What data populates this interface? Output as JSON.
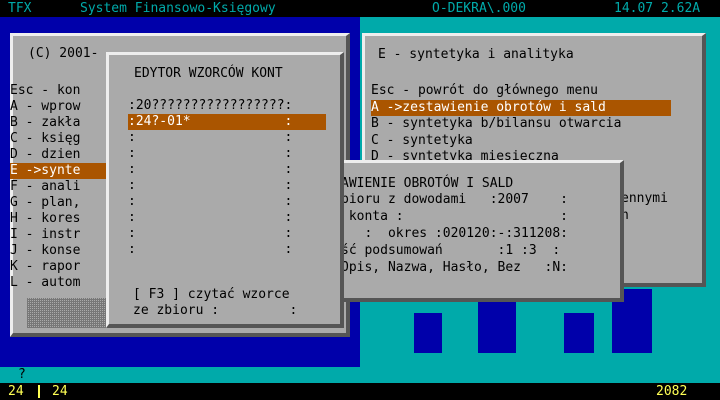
{
  "topbar": {
    "app": "TFX",
    "title": "System Finansowo-Księgowy",
    "path": "O-DEKRA\\.000",
    "time_version": "14.07 2.62A"
  },
  "main_menu": {
    "header": "(C) 2001-",
    "items": [
      "Esc - kon",
      "A - wprow",
      "B - zakła",
      "C - księg",
      "D - dzien",
      "E ->synte",
      "F - anali",
      "G - plan,",
      "H - kores",
      "I - instr",
      "J - konse",
      "K - rapor",
      "L - autom"
    ],
    "selected_index": 5
  },
  "synth_menu": {
    "title": "E - syntetyka i analityka",
    "items": [
      "Esc - powrót do głównego menu",
      "A ->zestawienie obrotów i sald",
      "B - syntetyka b/bilansu otwarcia",
      "C - syntetyka",
      "D - syntetyka miesięczna"
    ],
    "selected_index": 1,
    "partial_right_1": "ennymi",
    "partial_right_2": "h"
  },
  "editor": {
    "title": "EDYTOR WZORCÓW KONT",
    "rows": [
      ":20?????????????????:",
      ":24?-01*            :",
      ":                   :",
      ":                   :",
      ":                   :",
      ":                   :",
      ":                   :",
      ":                   :",
      ":                   :",
      ":                   :"
    ],
    "selected_index": 1,
    "footer_line1": "[ F3 ] czytać wzorce",
    "footer_line2": "ze zbioru :         :"
  },
  "obroty": {
    "title": "AWIENIE OBROTÓW I SALD",
    "lines": [
      "bioru z dowodami   :2007    :",
      " konta :                    :",
      "   :  okres :020120:-:311208:",
      "ść podsumowań       :1 :3  :",
      "Opis, Nazwa, Hasło, Bez   :N:"
    ]
  },
  "cmdline": {
    "prompt": "?"
  },
  "statusbar": {
    "left1": "24",
    "left2": "24",
    "right": "2082"
  }
}
